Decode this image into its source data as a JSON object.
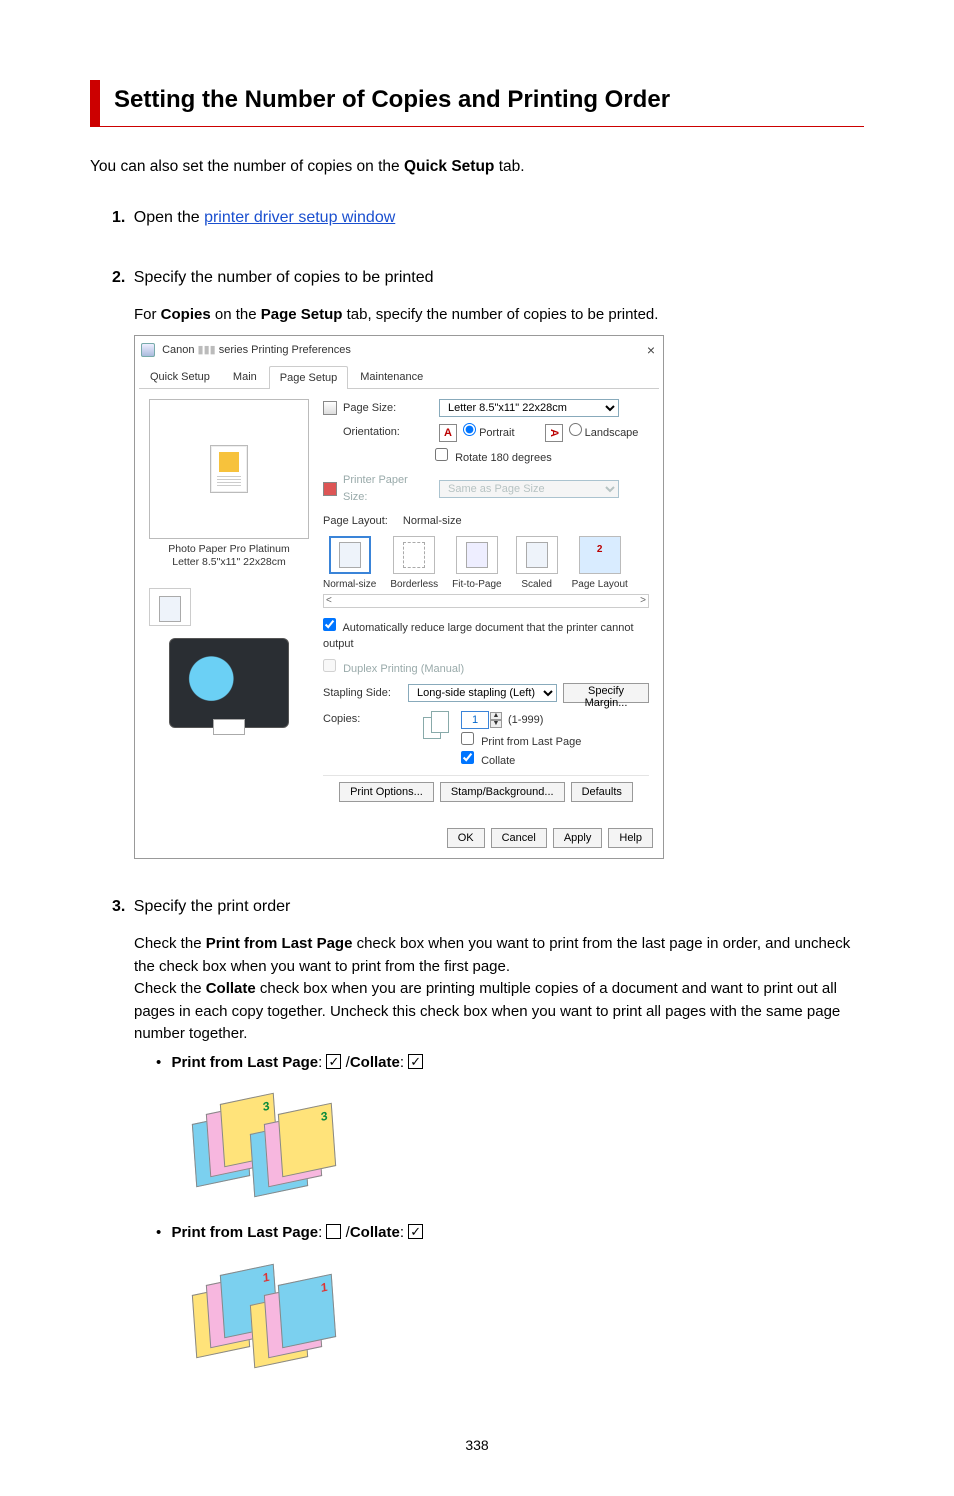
{
  "page_number": "338",
  "title": "Setting the Number of Copies and Printing Order",
  "intro_pre": "You can also set the number of copies on the ",
  "intro_bold": "Quick Setup",
  "intro_post": " tab.",
  "steps": {
    "1": {
      "num": "1.",
      "lead": "Open the ",
      "link": "printer driver setup window"
    },
    "2": {
      "num": "2.",
      "title": "Specify the number of copies to be printed",
      "body_pre": "For ",
      "b1": "Copies",
      "mid": " on the ",
      "b2": "Page Setup",
      "body_post": " tab, specify the number of copies to be printed."
    },
    "3": {
      "num": "3.",
      "title": "Specify the print order",
      "p1_a": "Check the ",
      "p1_b1": "Print from Last Page",
      "p1_b": " check box when you want to print from the last page in order, and uncheck the check box when you want to print from the first page.",
      "p2_a": "Check the ",
      "p2_b1": "Collate",
      "p2_b": " check box when you are printing multiple copies of a document and want to print out all pages in each copy together. Uncheck this check box when you want to print all pages with the same page number together."
    }
  },
  "combos": {
    "label_pflp": "Print from Last Page",
    "label_collate": "Collate",
    "sep": ": ",
    "slash": " /"
  },
  "dialog": {
    "title_prefix": "Canon",
    "title_suffix": "series Printing Preferences",
    "tabs": {
      "quick": "Quick Setup",
      "main": "Main",
      "page": "Page Setup",
      "maint": "Maintenance"
    },
    "page_size_lbl": "Page Size:",
    "page_size_val": "Letter 8.5\"x11\" 22x28cm",
    "orientation_lbl": "Orientation:",
    "portrait": "Portrait",
    "landscape": "Landscape",
    "rotate": "Rotate 180 degrees",
    "printer_paper_lbl": "Printer Paper Size:",
    "printer_paper_val": "Same as Page Size",
    "page_layout_lbl": "Page Layout:",
    "page_layout_val": "Normal-size",
    "layouts": {
      "normal": "Normal-size",
      "borderless": "Borderless",
      "fit": "Fit-to-Page",
      "scaled": "Scaled",
      "pagelayout": "Page Layout"
    },
    "auto_reduce": "Automatically reduce large document that the printer cannot output",
    "duplex": "Duplex Printing (Manual)",
    "stapling_lbl": "Stapling Side:",
    "stapling_val": "Long-side stapling (Left)",
    "specify_margin": "Specify Margin...",
    "copies_lbl": "Copies:",
    "copies_val": "1",
    "copies_range": "(1-999)",
    "print_last": "Print from Last Page",
    "collate": "Collate",
    "print_options": "Print Options...",
    "stamp": "Stamp/Background...",
    "defaults": "Defaults",
    "ok": "OK",
    "cancel": "Cancel",
    "apply": "Apply",
    "help": "Help",
    "media1": "Photo Paper Pro Platinum",
    "media2": "Letter 8.5\"x11\" 22x28cm",
    "pl_num": "2"
  }
}
